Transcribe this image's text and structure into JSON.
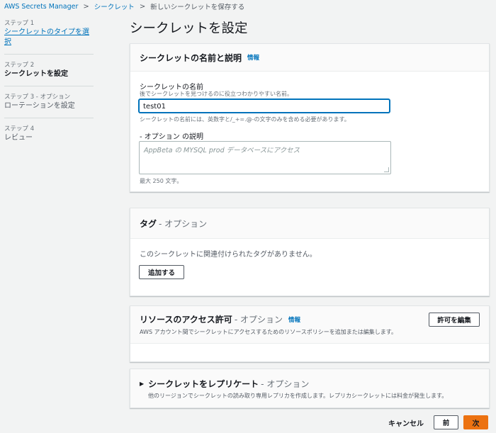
{
  "breadcrumb": {
    "items": [
      "AWS Secrets Manager",
      "シークレット"
    ],
    "current": "新しいシークレットを保存する"
  },
  "nav": {
    "steps": [
      {
        "num": "ステップ 1",
        "label": "シークレットのタイプを選択"
      },
      {
        "num": "ステップ 2",
        "label": "シークレットを設定"
      },
      {
        "num": "ステップ 3 - オプション",
        "label": "ローテーションを設定"
      },
      {
        "num": "ステップ 4",
        "label": "レビュー"
      }
    ]
  },
  "page_title": "シークレットを設定",
  "name_panel": {
    "title": "シークレットの名前と説明",
    "info": "情報",
    "name_label": "シークレットの名前",
    "name_desc": "後でシークレットを見つけるのに役立つわかりやすい名前。",
    "name_value": "test01",
    "name_hint": "シークレットの名前には、英数字と/_+=.@-の文字のみを含める必要があります。",
    "desc_label": "- オプション の説明",
    "desc_placeholder": "AppBeta の MYSQL prod データベースにアクセス",
    "desc_hint": "最大 250 文字。"
  },
  "tags_panel": {
    "title": "タグ",
    "optional": "- オプション",
    "empty_text": "このシークレットに関連付けられたタグがありません。",
    "add_button": "追加する"
  },
  "permissions_panel": {
    "title": "リソースのアクセス許可",
    "optional": "- オプション",
    "info": "情報",
    "desc": "AWS アカウント間でシークレットにアクセスするためのリソースポリシーを追加または編集します。",
    "edit_button": "許可を編集"
  },
  "replicate_panel": {
    "caret": "▶",
    "title": "シークレットをレプリケート",
    "optional": "- オプション",
    "desc": "他のリージョンでシークレットの読み取り専用レプリカを作成します。レプリカシークレットには料金が発生します。"
  },
  "footer": {
    "cancel": "キャンセル",
    "prev": "前",
    "next": "次"
  },
  "colors": {
    "link": "#0073bb",
    "primary_button": "#ec7211",
    "background": "#f2f3f3"
  }
}
